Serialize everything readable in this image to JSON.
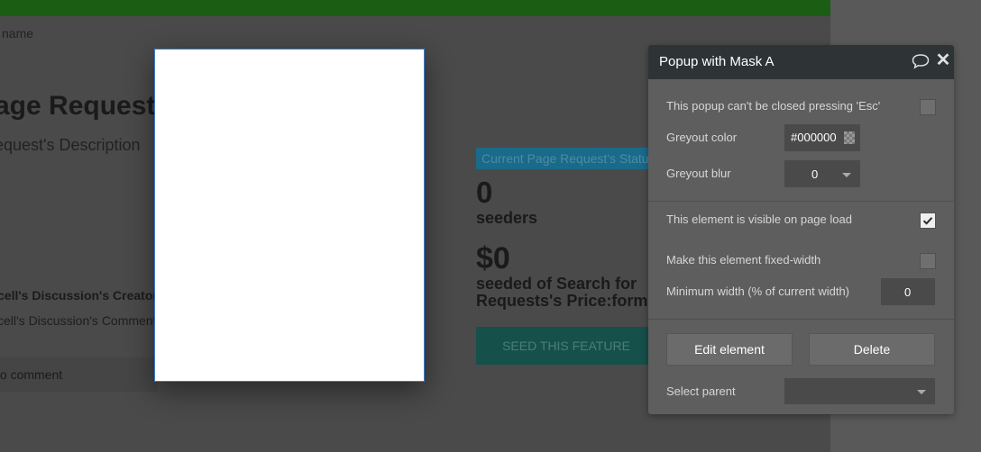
{
  "background": {
    "name_label": "name",
    "title": "age Request'",
    "description": "equest's Description",
    "creator": "cell's Discussion's Creator's",
    "comment": "cell's Discussion's Comment",
    "comment_prompt": "to comment",
    "status_badge": "Current Page Request's Status",
    "seeders_count": "0",
    "seeders_label": "seeders",
    "price": "$0",
    "seeded_text_1": "seeded of Search for",
    "seeded_text_2": "Requests's Price:form...",
    "seed_button": "SEED THIS FEATURE"
  },
  "panel": {
    "title": "Popup with Mask A",
    "esc_label": "This popup can't be closed pressing 'Esc'",
    "esc_checked": false,
    "greyout_color_label": "Greyout color",
    "greyout_color_value": "#000000",
    "greyout_blur_label": "Greyout blur",
    "greyout_blur_value": "0",
    "visible_label": "This element is visible on page load",
    "visible_checked": true,
    "fixed_width_label": "Make this element fixed-width",
    "fixed_width_checked": false,
    "min_width_label": "Minimum width (% of current width)",
    "min_width_value": "0",
    "edit_button": "Edit element",
    "delete_button": "Delete",
    "select_parent_label": "Select parent",
    "select_parent_value": ""
  },
  "icons": {
    "comment": "comment-icon",
    "close": "close-icon",
    "check": "check-icon",
    "dropdown": "chevron-down-icon"
  },
  "colors": {
    "header_bar": "#1c5d14",
    "popup_border": "#3a7ad0",
    "panel_header": "#2e3436"
  }
}
